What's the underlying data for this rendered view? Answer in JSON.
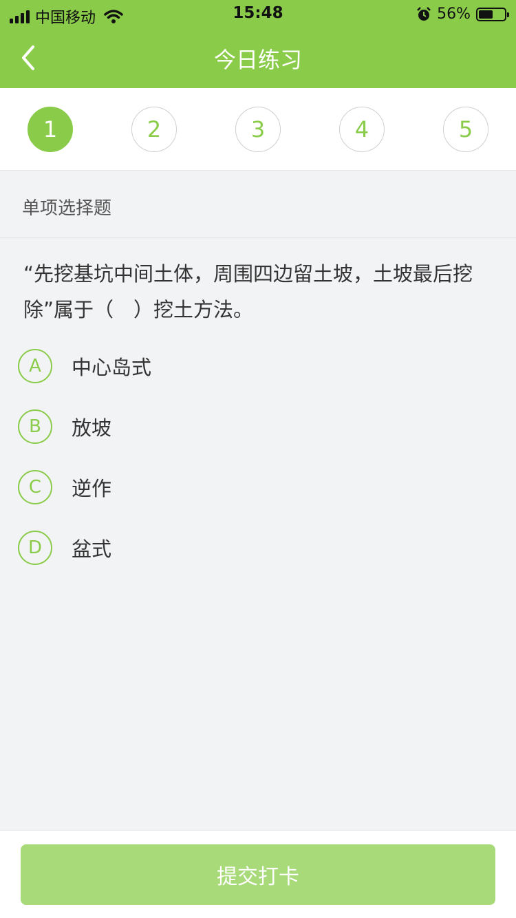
{
  "status_bar": {
    "carrier": "中国移动",
    "time": "15:48",
    "battery_percent": "56%",
    "icons": [
      "signal-icon",
      "wifi-icon",
      "alarm-icon",
      "battery-icon"
    ]
  },
  "nav": {
    "title": "今日练习",
    "back_icon": "chevron-left-icon"
  },
  "steps": [
    {
      "label": "1",
      "active": true
    },
    {
      "label": "2",
      "active": false
    },
    {
      "label": "3",
      "active": false
    },
    {
      "label": "4",
      "active": false
    },
    {
      "label": "5",
      "active": false
    }
  ],
  "question": {
    "type": "单项选择题",
    "text": "“先挖基坑中间土体，周围四边留土坡，土坡最后挖除”属于（　）挖土方法。",
    "options": [
      {
        "key": "A",
        "text": "中心岛式"
      },
      {
        "key": "B",
        "text": "放坡"
      },
      {
        "key": "C",
        "text": "逆作"
      },
      {
        "key": "D",
        "text": "盆式"
      }
    ]
  },
  "submit_label": "提交打卡",
  "colors": {
    "primary": "#8acc4a",
    "submit_disabled": "#a8da7a",
    "background": "#f2f3f5"
  }
}
